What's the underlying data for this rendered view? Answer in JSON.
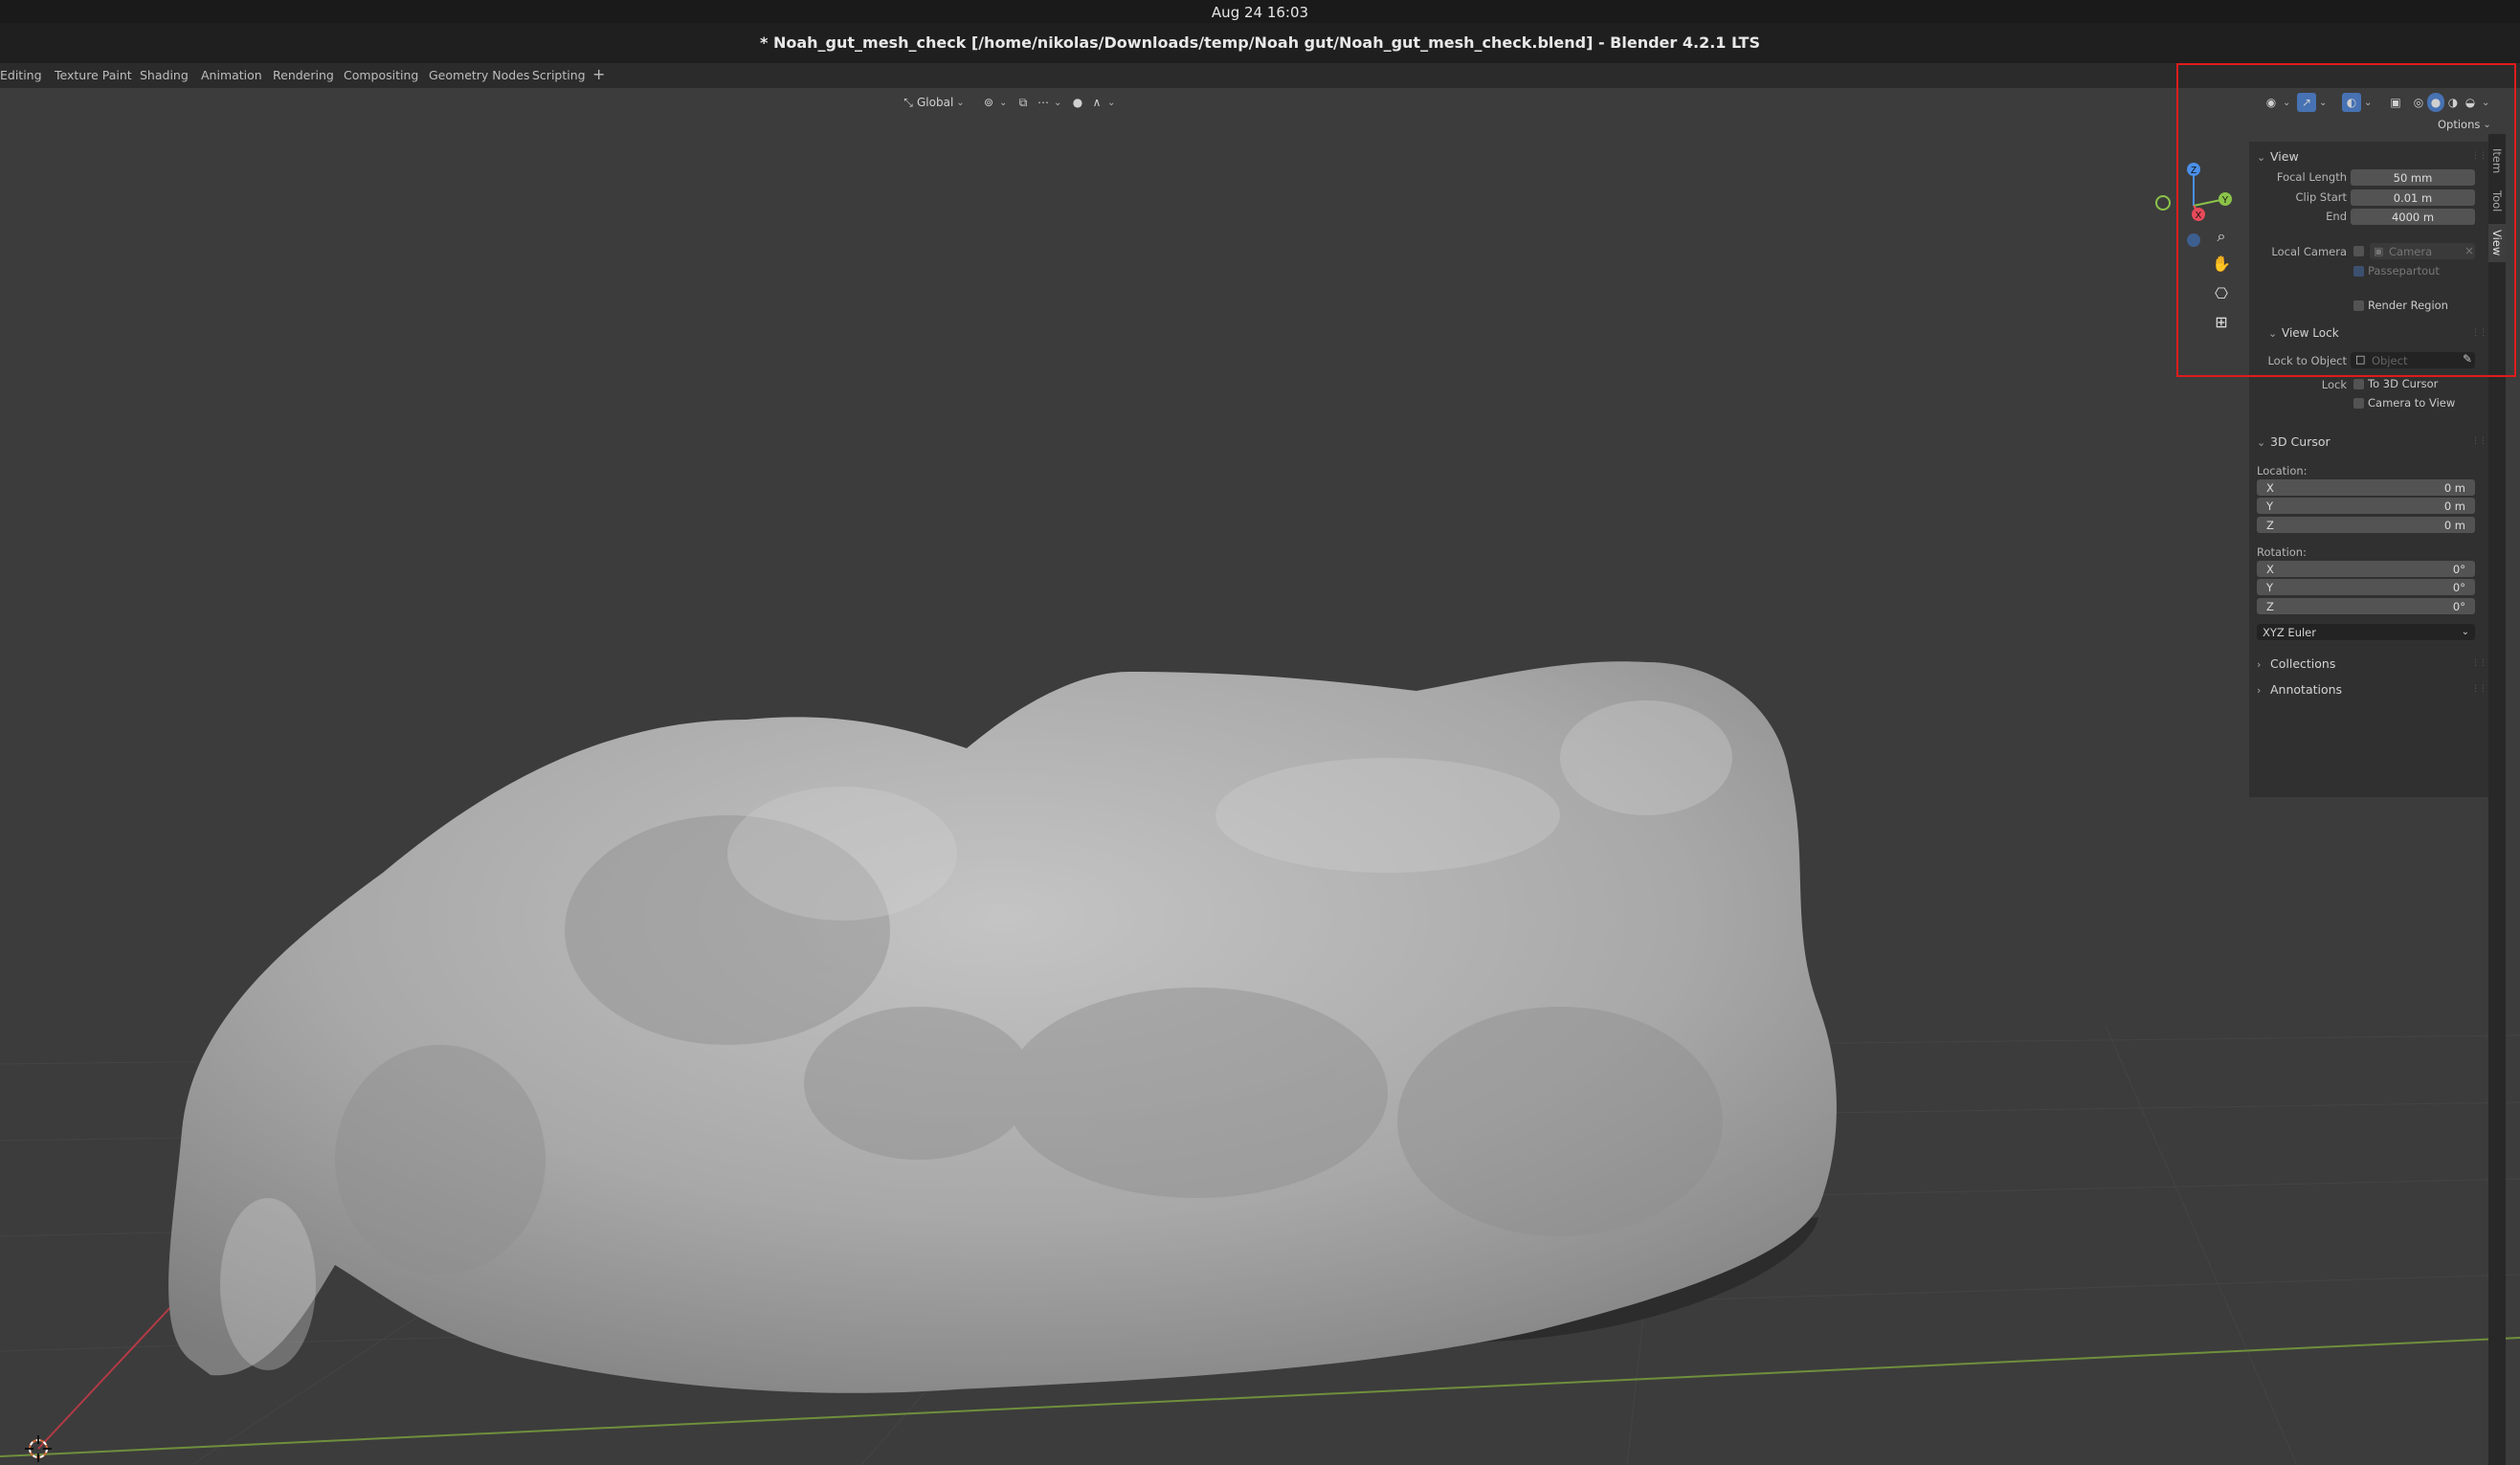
{
  "os": {
    "clock": "Aug 24  16:03"
  },
  "window": {
    "title": "* Noah_gut_mesh_check [/home/nikolas/Downloads/temp/Noah gut/Noah_gut_mesh_check.blend] - Blender 4.2.1 LTS"
  },
  "workspaces": {
    "tabs": [
      "Editing",
      "Texture Paint",
      "Shading",
      "Animation",
      "Rendering",
      "Compositing",
      "Geometry Nodes",
      "Scripting"
    ],
    "add_label": "+"
  },
  "viewport_header": {
    "orientation": "Global",
    "options_label": "Options"
  },
  "gizmo": {
    "z": "Z",
    "x": "X",
    "y": "Y"
  },
  "sidebar_tabs": [
    "Item",
    "Tool",
    "View"
  ],
  "view_panel": {
    "title": "View",
    "focal_length_label": "Focal Length",
    "focal_length_value": "50 mm",
    "clip_start_label": "Clip Start",
    "clip_start_value": "0.01 m",
    "clip_end_label": "End",
    "clip_end_value": "4000 m",
    "local_camera_label": "Local Camera",
    "local_camera_placeholder": "Camera",
    "passepartout_label": "Passepartout",
    "render_region_label": "Render Region",
    "view_lock_title": "View Lock",
    "lock_to_object_label": "Lock to Object",
    "lock_to_object_placeholder": "Object",
    "lock_label": "Lock",
    "to_3d_cursor_label": "To 3D Cursor",
    "camera_to_view_label": "Camera to View"
  },
  "cursor_panel": {
    "title": "3D Cursor",
    "location_label": "Location:",
    "location": [
      {
        "axis": "X",
        "value": "0 m"
      },
      {
        "axis": "Y",
        "value": "0 m"
      },
      {
        "axis": "Z",
        "value": "0 m"
      }
    ],
    "rotation_label": "Rotation:",
    "rotation": [
      {
        "axis": "X",
        "value": "0°"
      },
      {
        "axis": "Y",
        "value": "0°"
      },
      {
        "axis": "Z",
        "value": "0°"
      }
    ],
    "rotation_mode": "XYZ Euler"
  },
  "collapsed_panels": [
    "Collections",
    "Annotations"
  ],
  "colors": {
    "viewport_bg": "#3c3c3c",
    "mesh": "#a9a9a9",
    "axis_x": "#e84a5a",
    "axis_y": "#8bc34a",
    "axis_z": "#4a8fe8",
    "highlight": "#e01c1c",
    "accent": "#4772b3"
  }
}
